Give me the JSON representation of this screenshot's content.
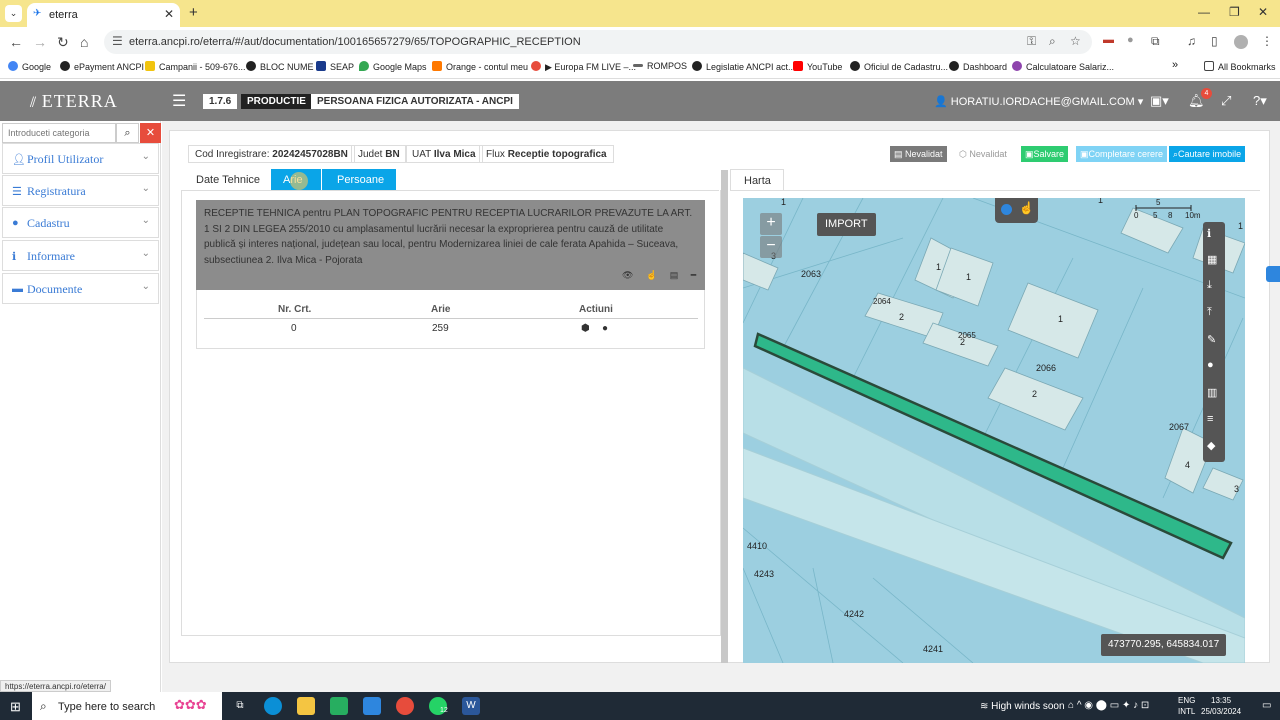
{
  "browser": {
    "tab_title": "eterra",
    "url": "eterra.ancpi.ro/eterra/#/aut/documentation/100165657279/65/TOPOGRAPHIC_RECEPTION",
    "bookmarks": [
      "Google",
      "ePayment ANCPI",
      "Campanii - 509-676...",
      "BLOC NUME",
      "SEAP",
      "Google Maps",
      "Orange - contul meu",
      "▶ Europa FM LIVE –...",
      "ROMPOS",
      "Legislatie ANCPI act...",
      "YouTube",
      "Oficiul de Cadastru...",
      "Dashboard",
      "Calculatoare Salariz..."
    ],
    "all_bookmarks": "All Bookmarks",
    "status_link": "https://eterra.ancpi.ro/eterra/"
  },
  "header": {
    "logo": "ETERRA",
    "version": "1.7.6",
    "env": "PRODUCTIE",
    "role": "PERSOANA FIZICA AUTORIZATA - ANCPI",
    "user": "HORATIU.IORDACHE@GMAIL.COM",
    "notif_count": "4"
  },
  "sidebar": {
    "search_placeholder": "Introduceti categoria",
    "items": [
      {
        "label": "Profil Utilizator",
        "icon": "user-icon"
      },
      {
        "label": "Registratura",
        "icon": "list-icon"
      },
      {
        "label": "Cadastru",
        "icon": "globe-icon"
      },
      {
        "label": "Informare",
        "icon": "info-icon"
      },
      {
        "label": "Documente",
        "icon": "folder-icon"
      }
    ]
  },
  "info": {
    "cod_label": "Cod Inregistrare:",
    "cod_value": "20242457028BN",
    "judet_label": "Judet",
    "judet_value": "BN",
    "uat_label": "UAT",
    "uat_value": "Ilva Mica",
    "flux_label": "Flux",
    "flux_value": "Receptie topografica"
  },
  "actions": {
    "nevalidat1": "Nevalidat",
    "nevalidat2": "Nevalidat",
    "salvare": "Salvare",
    "completare": "Completare cerere",
    "cautare": "Cautare imobile"
  },
  "tabs": {
    "date_tehnice": "Date Tehnice",
    "arie": "Arie",
    "persoane": "Persoane",
    "harta": "Harta"
  },
  "description": "RECEPTIE TEHNICA pentru PLAN TOPOGRAFIC PENTRU RECEPTIA LUCRARILOR PREVAZUTE LA ART. 1 SI 2 DIN LEGEA 255/2010 cu amplasamentul lucrării necesar la exproprierea pentru cauză de utilitate publică și interes național, județean sau local, pentru Modernizarea liniei de cale ferata Apahida – Suceava, subsectiunea 2. Ilva Mica - Pojorata",
  "table": {
    "headers": [
      "Nr. Crt.",
      "Arie",
      "Actiuni"
    ],
    "rows": [
      {
        "nr": "0",
        "arie": "259"
      }
    ]
  },
  "map": {
    "import": "IMPORT",
    "coords": "473770.295, 645834.017",
    "scale": "5",
    "scale_ticks": [
      "0",
      "5",
      "8",
      "10m"
    ],
    "labels": [
      "2063",
      "2064",
      "2065",
      "2066",
      "2067",
      "4410",
      "4243",
      "4242",
      "4241",
      "1",
      "1",
      "1",
      "2",
      "2",
      "2",
      "3",
      "3",
      "4",
      "1",
      "1",
      "1"
    ]
  },
  "taskbar": {
    "search_placeholder": "Type here to search",
    "weather": "High winds soon",
    "lang1": "ENG",
    "lang2": "INTL",
    "time": "13:35",
    "date": "25/03/2024",
    "whatsapp_badge": "12"
  }
}
